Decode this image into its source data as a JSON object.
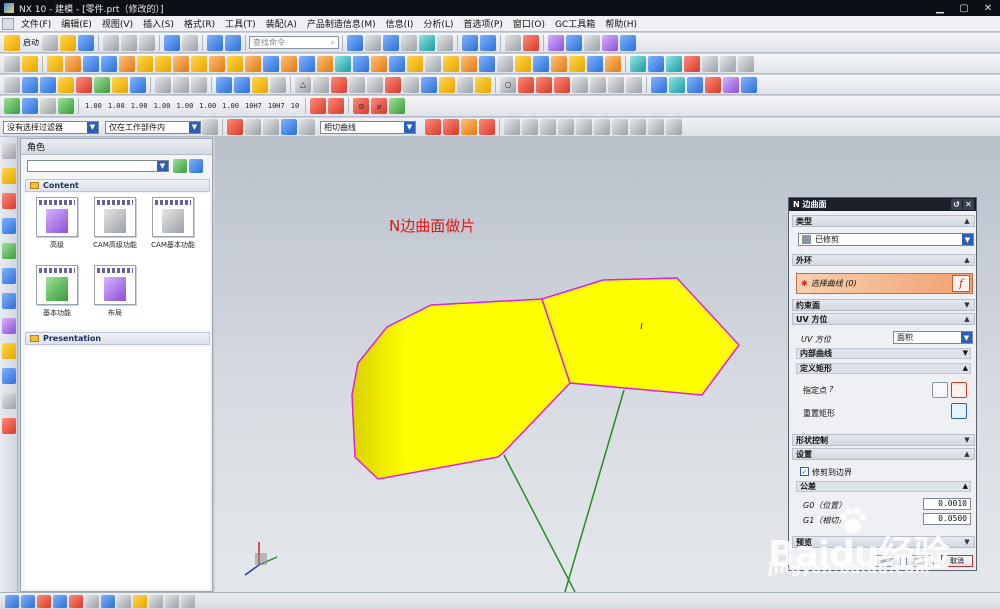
{
  "window": {
    "title": "NX 10 - 建模 - [零件.prt（修改的）]"
  },
  "menu": [
    "文件(F)",
    "编辑(E)",
    "视图(V)",
    "插入(S)",
    "格式(R)",
    "工具(T)",
    "装配(A)",
    "产品制造信息(M)",
    "信息(I)",
    "分析(L)",
    "首选项(P)",
    "窗口(O)",
    "GC工具箱",
    "帮助(H)"
  ],
  "toolbar": {
    "start_label": "启动",
    "search_placeholder": "查找命令",
    "dim_labels": [
      "1.00",
      "1.00",
      "1.00",
      "1.00",
      "1.00",
      "1.00",
      "1.00",
      "10H7",
      "10H7",
      "10"
    ],
    "filter_select": "没有选择过滤器",
    "scope_select": "仅在工作部件内",
    "curve_rule_select": "相切曲线"
  },
  "navigator": {
    "title": "角色",
    "content_section": "Content",
    "presentation_section": "Presentation",
    "roles": [
      "高级",
      "CAM高级功能",
      "CAM基本功能",
      "基本功能",
      "布局"
    ]
  },
  "graphics": {
    "annotation": "N边曲面做片",
    "surface_color": "#ffff00",
    "edge_color": "#e020e0",
    "line_color": "#2a8a2a"
  },
  "dialog": {
    "title": "N 边曲面",
    "type_section": "类型",
    "type_value": "已修剪",
    "outer_loop_section": "外环",
    "select_curve": "选择曲线 (0)",
    "constraint_section": "约束面",
    "uv_section": "UV 方位",
    "uv_label": "UV 方位",
    "uv_value": "面积",
    "inner_curve_sub": "内部曲线",
    "define_rect_sub": "定义矩形",
    "specify_point": "指定点",
    "reset_rect": "重置矩形",
    "shape_control_section": "形状控制",
    "settings_section": "设置",
    "trim_to_boundary": "修剪到边界",
    "tolerance_sub": "公差",
    "g0_label": "G0（位置）",
    "g0_value": "0.0010",
    "g1_label": "G1（相切）",
    "g1_value": "0.0500",
    "preview_section": "预览",
    "ok": "确定",
    "apply": "应用",
    "cancel": "取消"
  },
  "watermark": {
    "line1": "Baidu经验",
    "line2": "jingyan.baidu.com"
  }
}
